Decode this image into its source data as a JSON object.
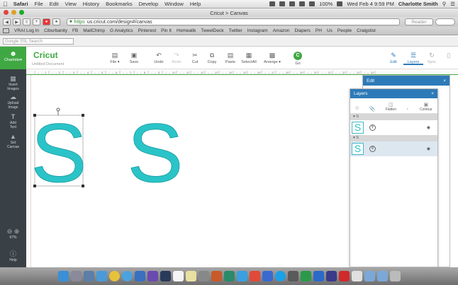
{
  "menubar": {
    "items": [
      "Safari",
      "File",
      "Edit",
      "View",
      "History",
      "Bookmarks",
      "Develop",
      "Window",
      "Help"
    ],
    "battery": "100%",
    "datetime": "Wed Feb 4  9:59 PM",
    "user": "Charlotte Smith"
  },
  "window": {
    "title": "Cricut > Canvas"
  },
  "browser": {
    "url_scheme": "https",
    "url_rest": "us.cricut.com/design#/canvas",
    "reader": "Reader"
  },
  "bookmarks": [
    "VRAI Log In",
    "Ciburbanity",
    "FB",
    "MailChimp",
    "G Analytics",
    "Pinterest",
    "Pin It",
    "Homeatik",
    "TweetDeck",
    "Twitter",
    "Instagram",
    "Amazon",
    "Diapers",
    "PH",
    "Us",
    "People",
    "Craigslist"
  ],
  "google": {
    "placeholder": "Google SSL Search"
  },
  "app": {
    "logo": "Cricut",
    "doc_name": "Untitled Document",
    "tools": {
      "file": "File",
      "save": "Save",
      "undo": "Undo",
      "redo": "Redo",
      "cut": "Cut",
      "copy": "Copy",
      "paste": "Paste",
      "select_all": "SelectAll",
      "arrange": "Arrange",
      "go": "Go"
    },
    "right_tools": {
      "edit": "Edit",
      "layers": "Layers",
      "sync": "Sync",
      "more": ""
    }
  },
  "sidebar": {
    "account": "Charlotte",
    "items": [
      {
        "label1": "Insert",
        "label2": "Images"
      },
      {
        "label1": "Upload",
        "label2": "Image"
      },
      {
        "label1": "Add",
        "label2": "Text"
      },
      {
        "label1": "Set",
        "label2": "Canvas"
      }
    ],
    "zoom": "67%",
    "help": "Help"
  },
  "canvas": {
    "letter1": "S",
    "letter2": "S",
    "shape_color": "#2ac4c8",
    "ruler_marks": [
      "1",
      "2",
      "3",
      "4",
      "5",
      "6",
      "7",
      "8",
      "9",
      "10",
      "11",
      "12",
      "13",
      "14",
      "15",
      "16",
      "17",
      "18",
      "19",
      "20",
      "21",
      "22",
      "23",
      "24"
    ]
  },
  "edit_panel": {
    "title": "Edit",
    "close": "×"
  },
  "layers_panel": {
    "title": "Layers",
    "close": "×",
    "tools": {
      "flatten": "Flatten",
      "contour": "Contour"
    },
    "groups": [
      {
        "name": "S",
        "layer": "S"
      },
      {
        "name": "S",
        "layer": "S"
      }
    ]
  },
  "colors": {
    "cricut_green": "#40a843",
    "panel_blue": "#2d7ab8",
    "sidebar_dark": "#3a4146"
  }
}
